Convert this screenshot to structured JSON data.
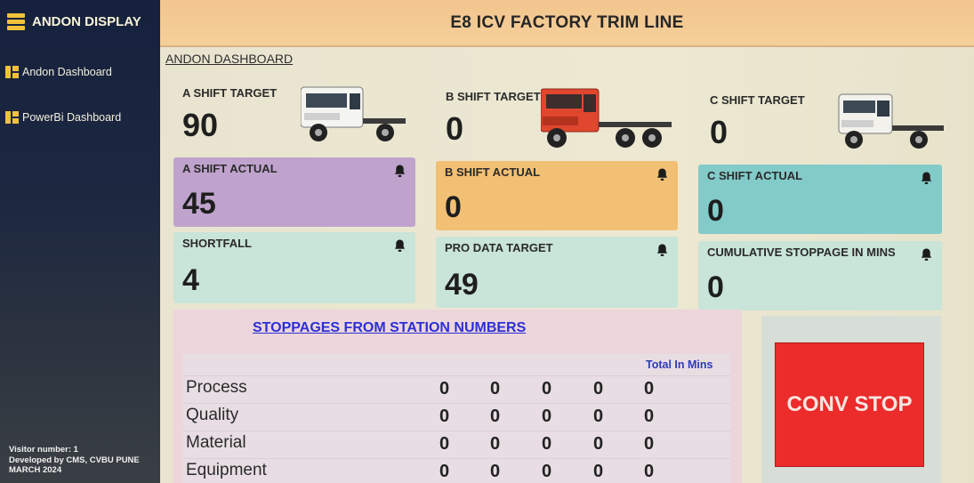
{
  "sidebar": {
    "brand": "ANDON DISPLAY",
    "nav": [
      {
        "label": "Andon Dashboard"
      },
      {
        "label": "PowerBi Dashboard"
      }
    ],
    "footer": {
      "visitor": "Visitor number: 1",
      "developed": "Developed by CMS, CVBU PUNE",
      "date": "MARCH 2024"
    }
  },
  "header": {
    "title": "E8 ICV FACTORY TRIM LINE"
  },
  "main": {
    "dashboard_link": "ANDON DASHBOARD",
    "targets": [
      {
        "label": "A SHIFT TARGET",
        "value": "90"
      },
      {
        "label": "B SHIFT TARGET",
        "value": "0"
      },
      {
        "label": "C SHIFT TARGET",
        "value": "0"
      }
    ],
    "actuals": [
      {
        "label": "A SHIFT ACTUAL",
        "value": "45"
      },
      {
        "label": "B SHIFT ACTUAL",
        "value": "0"
      },
      {
        "label": "C SHIFT ACTUAL",
        "value": "0"
      }
    ],
    "metrics": [
      {
        "label": "SHORTFALL",
        "value": "4"
      },
      {
        "label": "PRO DATA TARGET",
        "value": "49"
      },
      {
        "label": "CUMULATIVE STOPPAGE IN MINS",
        "value": "0"
      }
    ]
  },
  "stoppages": {
    "title": "STOPPAGES FROM STATION NUMBERS",
    "total_header": "Total In Mins",
    "rows": [
      {
        "name": "Process",
        "cells": [
          "0",
          "0",
          "0",
          "0",
          "0"
        ]
      },
      {
        "name": "Quality",
        "cells": [
          "0",
          "0",
          "0",
          "0",
          "0"
        ]
      },
      {
        "name": "Material",
        "cells": [
          "0",
          "0",
          "0",
          "0",
          "0"
        ]
      },
      {
        "name": "Equipment",
        "cells": [
          "0",
          "0",
          "0",
          "0",
          "0"
        ]
      }
    ]
  },
  "conv_stop": {
    "label": "CONV STOP"
  },
  "colors": {
    "card_purple": "#bfa3cd",
    "card_orange": "#f2c074",
    "card_teal": "#82cbc9",
    "card_mint": "#c9e4d8",
    "conv_red": "#ec2b2b",
    "link_blue": "#2c2fd6"
  },
  "icons": {
    "brand": "stack-icon",
    "nav": "dashboard-icon",
    "bell": "bell-icon"
  }
}
